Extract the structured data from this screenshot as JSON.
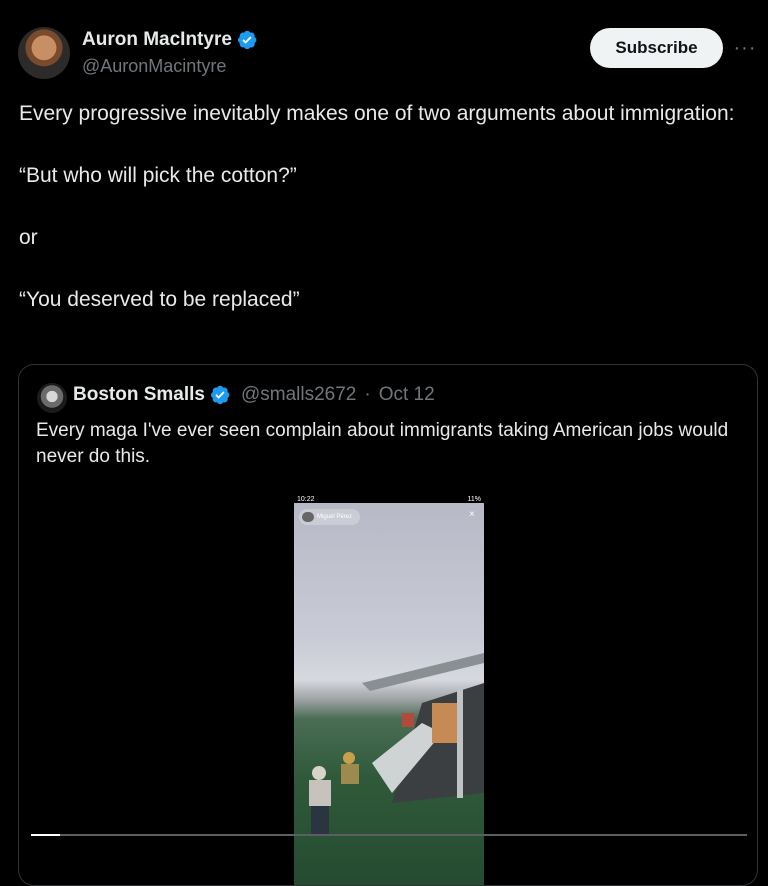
{
  "tweet": {
    "author_name": "Auron MacIntyre",
    "author_handle": "@AuronMacintyre",
    "subscribe_label": "Subscribe",
    "more_label": "···",
    "text_paragraphs": [
      "Every progressive inevitably makes one of two arguments about immigration:",
      "“But who will pick the cotton?”",
      "or",
      "“You deserved to be replaced”"
    ]
  },
  "quote": {
    "author_name": "Boston Smalls",
    "author_handle": "@smalls2672",
    "separator": "·",
    "date": "Oct 12",
    "text": "Every maga I've ever seen complain about immigrants taking American jobs would never do this.",
    "video": {
      "status_time": "10:22",
      "status_battery": "11%",
      "user_chip": "Miguel Pérez",
      "close_label": "×",
      "progress": 0.04
    }
  },
  "colors": {
    "background": "#000000",
    "text_primary": "#e7e9ea",
    "text_secondary": "#71767b",
    "verified_blue": "#1d9bf0",
    "border": "#2f3336"
  },
  "icons": {
    "verified": "verified-badge-icon",
    "more": "more-horizontal-icon",
    "close": "close-icon"
  }
}
